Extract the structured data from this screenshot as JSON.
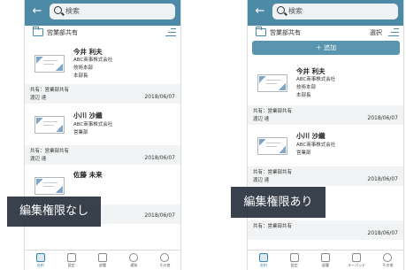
{
  "search": {
    "placeholder": "検索"
  },
  "left": {
    "folder": "営業部共有",
    "cards": [
      {
        "name": "今井 利夫",
        "company": "ABC商事株式会社",
        "dept": "技術本部",
        "title": "本部長",
        "share": "共有：営業部共有",
        "owner": "渡辺 達",
        "date": "2018/06/07"
      },
      {
        "name": "小川 沙織",
        "company": "ABC商事株式会社",
        "dept": "営業部",
        "title": "",
        "share": "共有：営業部共有",
        "owner": "渡辺 達",
        "date": "2018/06/07"
      },
      {
        "name": "佐藤 未来",
        "company": "",
        "dept": "",
        "title": "",
        "share": "",
        "owner": "",
        "date": "2018/06/07"
      }
    ],
    "tabs": [
      "名刺",
      "設定",
      "部署",
      "通知",
      "その他"
    ],
    "overlay": "編集権限なし"
  },
  "right": {
    "folder": "営業部共有",
    "select": "選択",
    "add_label": "＋ 追加",
    "cards": [
      {
        "name": "今井 利夫",
        "company": "ABC商事株式会社",
        "dept": "技術本部",
        "title": "本部長",
        "share": "共有：営業部共有",
        "owner": "渡辺 達",
        "date": "2018/06/07"
      },
      {
        "name": "小川 沙織",
        "company": "ABC商事株式会社",
        "dept": "営業部",
        "title": "",
        "share": "共有：営業部共有",
        "owner": "渡辺 達",
        "date": "2018/06/07"
      },
      {
        "name": "",
        "company": "",
        "dept": "",
        "title": "",
        "share": "共有：営業部共有",
        "owner": "",
        "date": "2018/06/07"
      }
    ],
    "tabs": [
      "名刺",
      "設定",
      "部署",
      "キーパッド",
      "その他"
    ],
    "overlay": "編集権限あり"
  },
  "colors": {
    "header": "#4c8aa6",
    "accent": "#3b86b0",
    "overlay": "#232c3a"
  }
}
